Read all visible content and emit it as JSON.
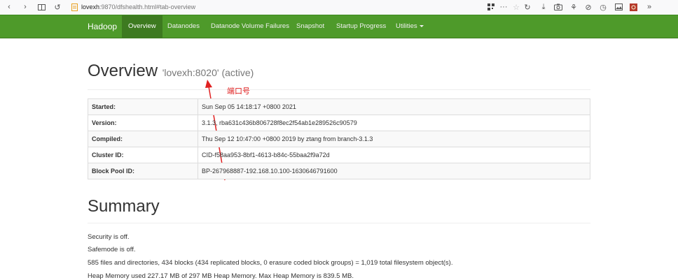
{
  "browser": {
    "url_host": "lovexh",
    "url_rest": ":9870/dfshealth.html#tab-overview",
    "more_icon": "···"
  },
  "navbar": {
    "brand": "Hadoop",
    "items": [
      {
        "label": "Overview",
        "active": true
      },
      {
        "label": "Datanodes"
      },
      {
        "label": "Datanode Volume Failures"
      },
      {
        "label": "Snapshot"
      },
      {
        "label": "Startup Progress"
      },
      {
        "label": "Utilities",
        "dropdown": true
      }
    ]
  },
  "overview": {
    "title": "Overview",
    "subtitle": "'lovexh:8020' (active)",
    "annotation": "端口号",
    "rows": [
      {
        "key": "Started:",
        "value": "Sun Sep 05 14:18:17 +0800 2021"
      },
      {
        "key": "Version:",
        "value": "3.1.3, rba631c436b806728f8ec2f54ab1e289526c90579"
      },
      {
        "key": "Compiled:",
        "value": "Thu Sep 12 10:47:00 +0800 2019 by ztang from branch-3.1.3"
      },
      {
        "key": "Cluster ID:",
        "value": "CID-f58aa953-8bf1-4613-b84c-55baa2f9a72d"
      },
      {
        "key": "Block Pool ID:",
        "value": "BP-267968887-192.168.10.100-1630646791600"
      }
    ]
  },
  "summary": {
    "title": "Summary",
    "lines": [
      "Security is off.",
      "Safemode is off.",
      "585 files and directories, 434 blocks (434 replicated blocks, 0 erasure coded block groups) = 1,019 total filesystem object(s).",
      "Heap Memory used 227.17 MB of 297 MB Heap Memory. Max Heap Memory is 839.5 MB."
    ]
  }
}
